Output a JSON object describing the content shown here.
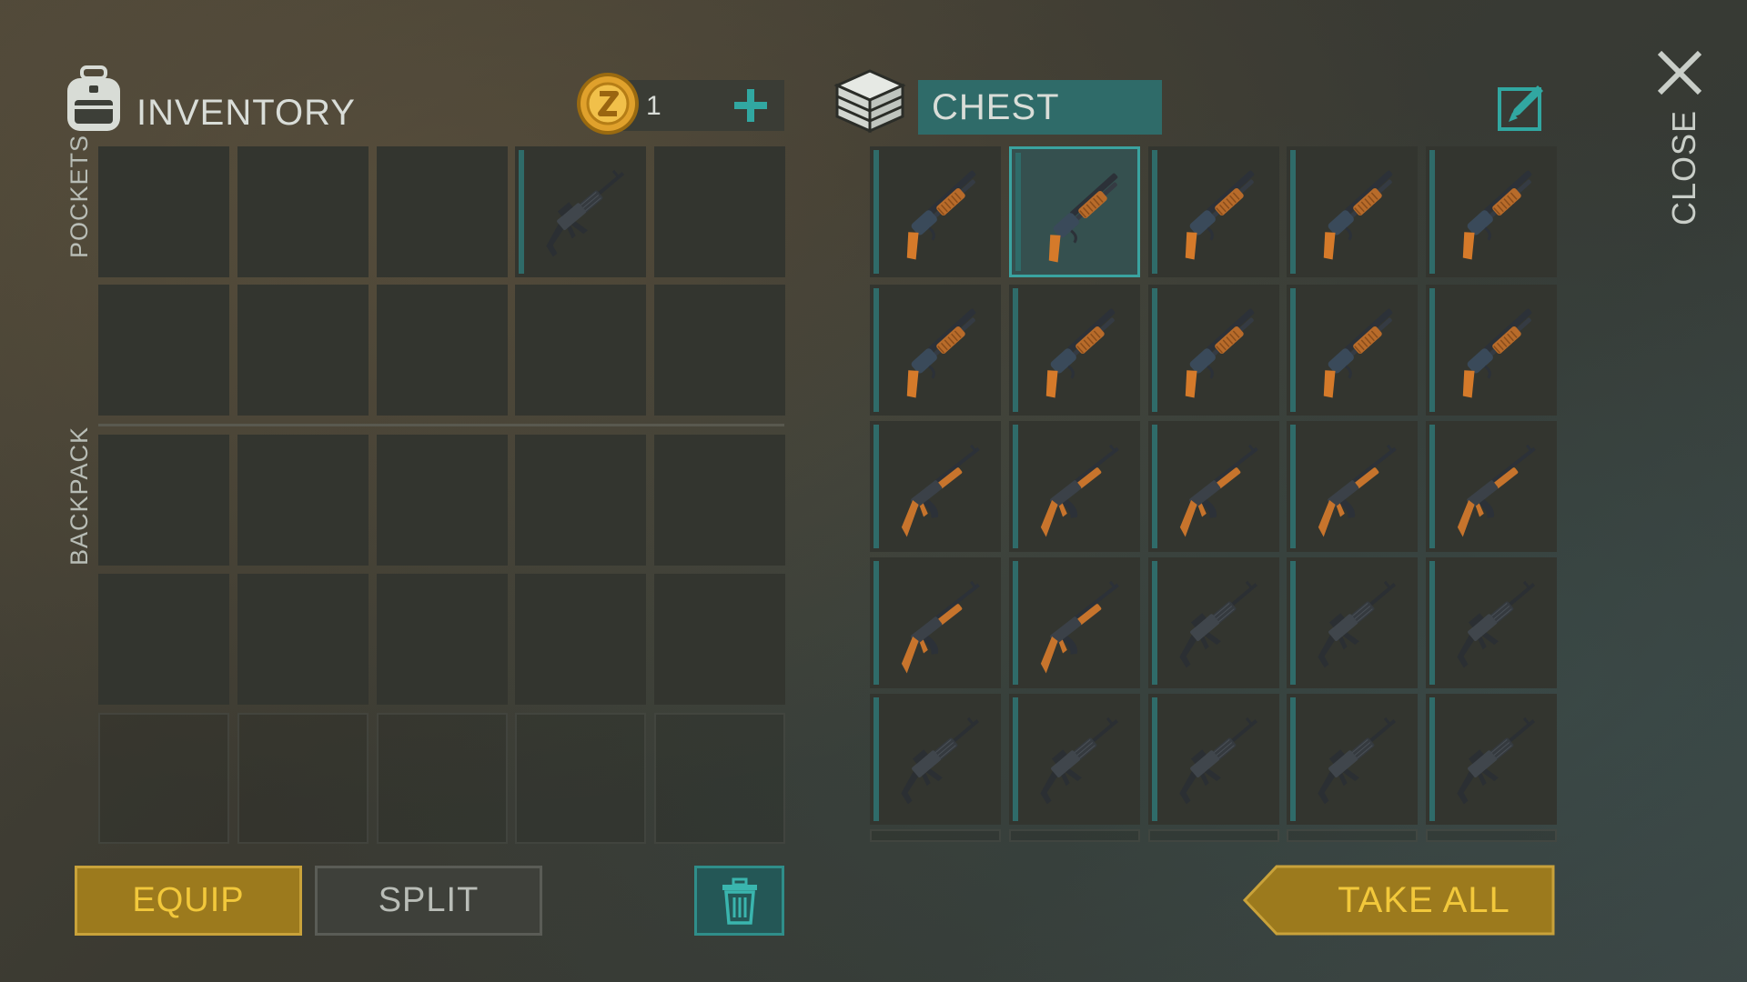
{
  "inventory": {
    "title": "INVENTORY",
    "pockets_label": "POCKETS",
    "backpack_label": "BACKPACK",
    "coins": "1",
    "add_icon": "plus-icon",
    "coin_icon": "gold-coin-icon",
    "backpack_icon": "backpack-icon",
    "pocket_items": [
      "",
      "",
      "",
      "m4-rifle",
      "",
      "",
      "",
      "",
      "",
      ""
    ]
  },
  "chest": {
    "title": "CHEST",
    "icon": "chest-icon",
    "edit_icon": "edit-icon",
    "items": [
      "shotgun",
      "shotgun",
      "shotgun",
      "shotgun",
      "shotgun",
      "shotgun",
      "shotgun",
      "shotgun",
      "shotgun",
      "shotgun",
      "ak47",
      "ak47",
      "ak47",
      "ak47",
      "ak47",
      "ak47",
      "ak47",
      "m4-rifle",
      "m4-rifle",
      "m4-rifle",
      "m4-rifle",
      "m4-rifle",
      "m4-rifle",
      "m4-rifle",
      "m4-rifle"
    ],
    "selected_index": 1
  },
  "close_label": "CLOSE",
  "buttons": {
    "equip": "EQUIP",
    "split": "SPLIT",
    "take_all": "TAKE ALL",
    "trash_icon": "trash-icon"
  },
  "colors": {
    "accent_teal": "#2f6b69",
    "gold": "#b08a22",
    "gold_text": "#f0c33a"
  }
}
